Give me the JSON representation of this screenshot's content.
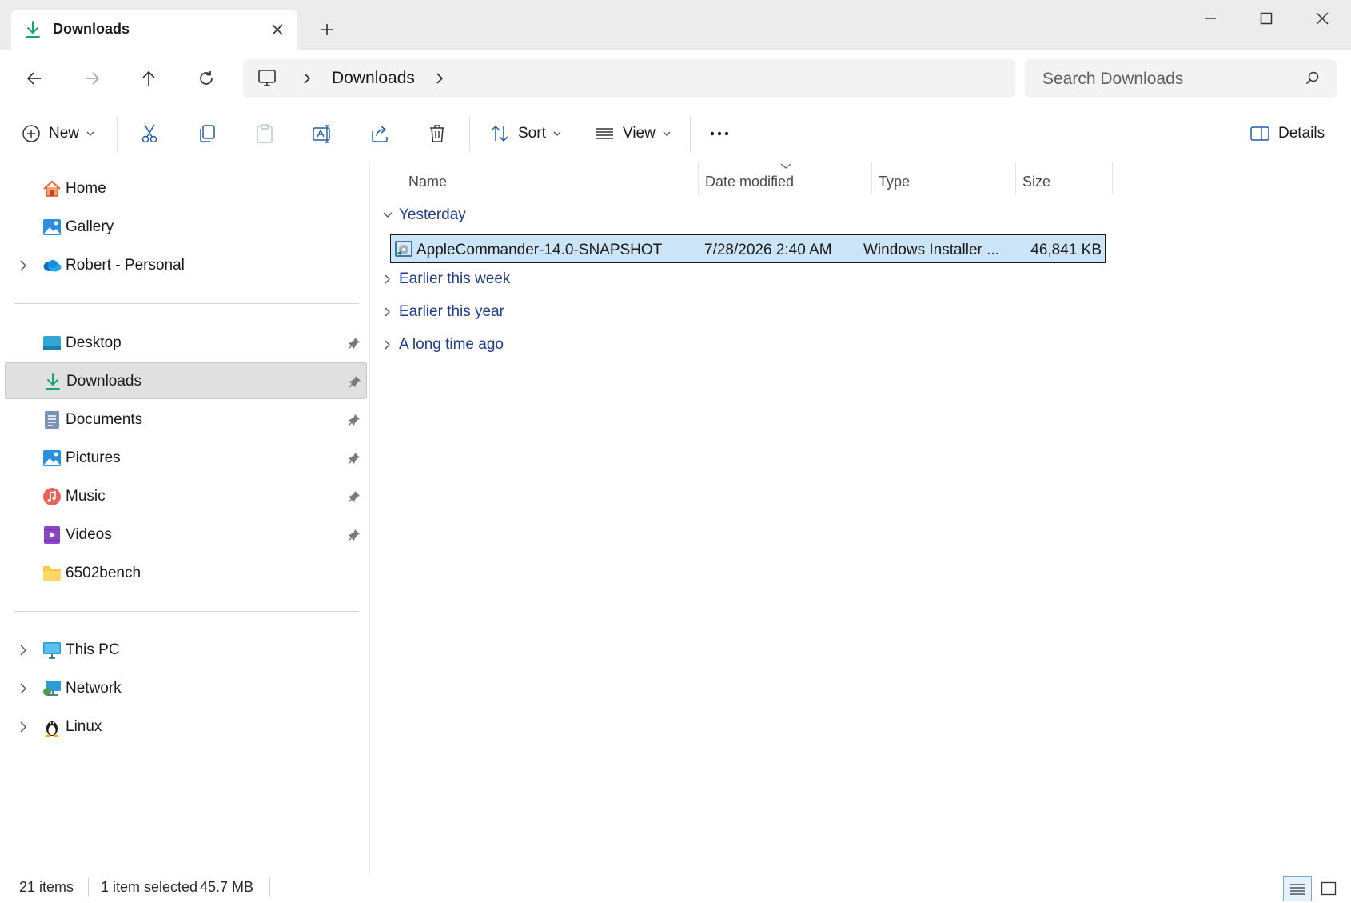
{
  "window": {
    "tab_title": "Downloads",
    "tab_icon": "download-icon"
  },
  "address": {
    "root_icon": "this-pc-icon",
    "current_folder": "Downloads",
    "search_placeholder": "Search Downloads"
  },
  "commandbar": {
    "new_label": "New",
    "sort_label": "Sort",
    "view_label": "View",
    "details_label": "Details"
  },
  "sidebar": {
    "items": [
      {
        "label": "Home",
        "icon": "home-icon"
      },
      {
        "label": "Gallery",
        "icon": "gallery-icon"
      },
      {
        "label": "Robert - Personal",
        "icon": "onedrive-icon"
      },
      {
        "label": "Desktop",
        "icon": "desktop-folder-icon"
      },
      {
        "label": "Downloads",
        "icon": "download-icon"
      },
      {
        "label": "Documents",
        "icon": "documents-icon"
      },
      {
        "label": "Pictures",
        "icon": "pictures-icon"
      },
      {
        "label": "Music",
        "icon": "music-icon"
      },
      {
        "label": "Videos",
        "icon": "videos-icon"
      },
      {
        "label": "6502bench",
        "icon": "folder-icon"
      },
      {
        "label": "This PC",
        "icon": "this-pc-icon"
      },
      {
        "label": "Network",
        "icon": "network-icon"
      },
      {
        "label": "Linux",
        "icon": "linux-icon"
      }
    ]
  },
  "content": {
    "columns": [
      "Name",
      "Date modified",
      "Type",
      "Size"
    ],
    "groups": [
      {
        "label": "Yesterday",
        "expanded": true
      },
      {
        "label": "Earlier this week",
        "expanded": false
      },
      {
        "label": "Earlier this year",
        "expanded": false
      },
      {
        "label": "A long time ago",
        "expanded": false
      }
    ],
    "files": [
      {
        "name": "AppleCommander-14.0-SNAPSHOT",
        "date_modified": "7/28/2026 2:40 AM",
        "type": "Windows Installer ...",
        "size": "46,841 KB",
        "icon": "msi-installer-icon",
        "selected": true
      }
    ]
  },
  "status": {
    "item_count": "21 items",
    "selection": "1 item selected",
    "selection_size": "45.7 MB"
  },
  "colors": {
    "accent": "#0067c0",
    "selection": "#cce4f7",
    "group_text": "#1f3d8c"
  }
}
